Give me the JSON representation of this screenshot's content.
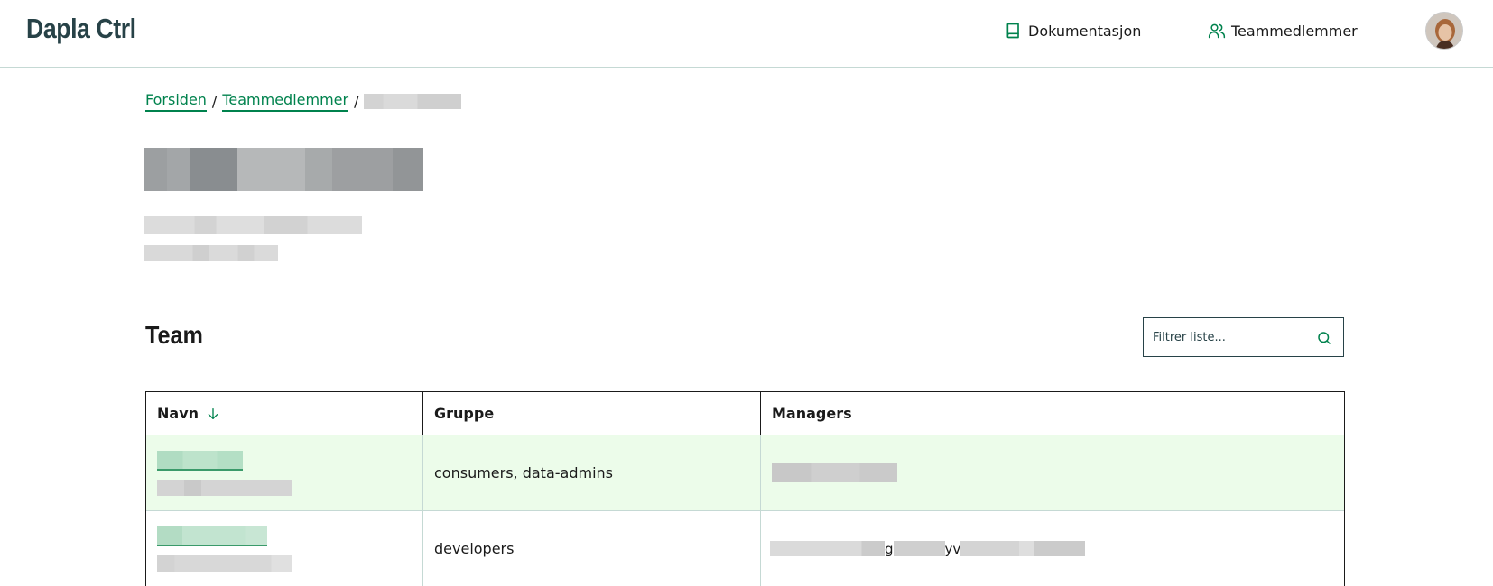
{
  "header": {
    "logo": "Dapla Ctrl",
    "nav": [
      {
        "label": "Dokumentasjon",
        "icon": "book-icon"
      },
      {
        "label": "Teammedlemmer",
        "icon": "users-icon"
      }
    ],
    "avatar_icon": "user-avatar"
  },
  "breadcrumb": {
    "items": [
      "Forsiden",
      "Teammedlemmer"
    ],
    "separator": "/"
  },
  "section": {
    "title": "Team",
    "filter_placeholder": "Filtrer liste...",
    "filter_icon": "search-icon"
  },
  "table": {
    "columns": [
      "Navn",
      "Gruppe",
      "Managers"
    ],
    "sort_icon": "arrow-down-icon",
    "rows": [
      {
        "gruppe": "consumers, data-admins"
      },
      {
        "gruppe": "developers",
        "managers_fragments": [
          "g",
          "yv"
        ]
      }
    ]
  },
  "colors": {
    "brand_dark": "#274247",
    "accent_green": "#00824d",
    "row_highlight": "#ecfcea"
  }
}
